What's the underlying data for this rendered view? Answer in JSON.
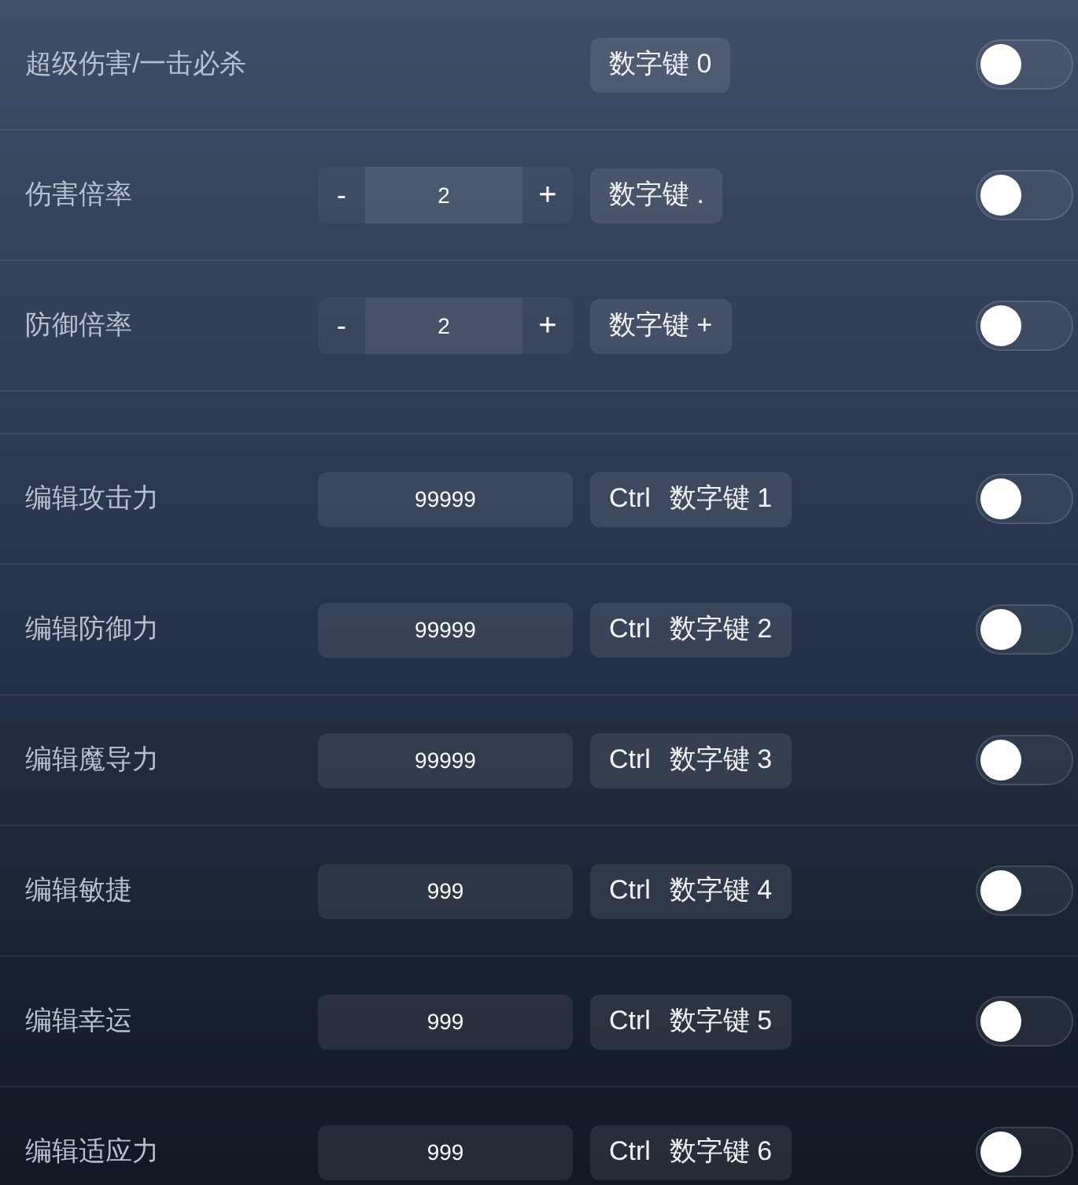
{
  "sections": [
    {
      "rows": [
        {
          "kind": "toggle",
          "label": "超级伤害/一击必杀",
          "hotkey": [
            "数字键 0"
          ],
          "on": false
        },
        {
          "kind": "stepper",
          "label": "伤害倍率",
          "decrement": "-",
          "value": "2",
          "increment": "+",
          "hotkey": [
            "数字键 ."
          ],
          "on": false
        },
        {
          "kind": "stepper",
          "label": "防御倍率",
          "decrement": "-",
          "value": "2",
          "increment": "+",
          "hotkey": [
            "数字键 +"
          ],
          "on": false
        }
      ]
    },
    {
      "rows": [
        {
          "kind": "input",
          "label": "编辑攻击力",
          "value": "99999",
          "hotkey": [
            "Ctrl",
            "数字键 1"
          ],
          "on": false
        },
        {
          "kind": "input",
          "label": "编辑防御力",
          "value": "99999",
          "hotkey": [
            "Ctrl",
            "数字键 2"
          ],
          "on": false
        },
        {
          "kind": "input",
          "label": "编辑魔导力",
          "value": "99999",
          "hotkey": [
            "Ctrl",
            "数字键 3"
          ],
          "on": false
        },
        {
          "kind": "input",
          "label": "编辑敏捷",
          "value": "999",
          "hotkey": [
            "Ctrl",
            "数字键 4"
          ],
          "on": false
        },
        {
          "kind": "input",
          "label": "编辑幸运",
          "value": "999",
          "hotkey": [
            "Ctrl",
            "数字键 5"
          ],
          "on": false
        },
        {
          "kind": "input",
          "label": "编辑适应力",
          "value": "999",
          "hotkey": [
            "Ctrl",
            "数字键 6"
          ],
          "on": false
        }
      ]
    }
  ]
}
